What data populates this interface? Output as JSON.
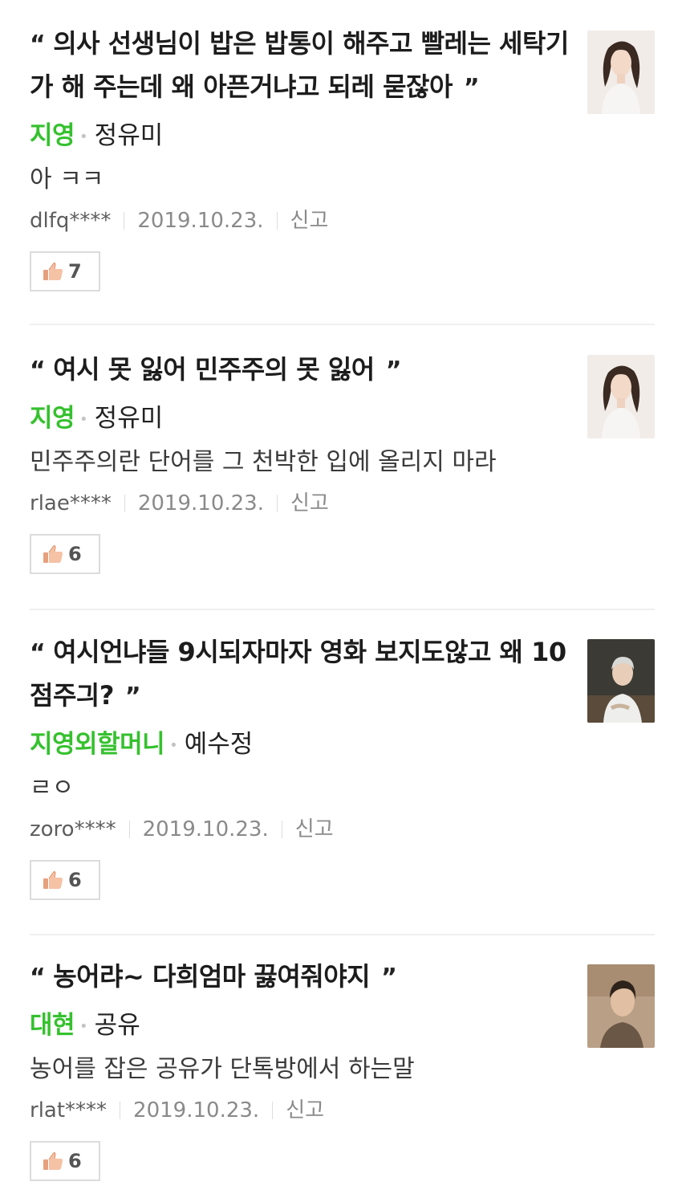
{
  "comments": [
    {
      "quote": "의사 선생님이 밥은 밥통이 해주고 빨레는 세탁기가 해 주는데 왜 아픈거냐고 되레 묻잖아",
      "role": "지영",
      "actor": "정유미",
      "text": "아 ㅋㅋ",
      "user": "dlfq****",
      "date": "2019.10.23.",
      "report_label": "신고",
      "likes": "7",
      "thumb_icon": "actress-portrait-1"
    },
    {
      "quote": "여시 못 잃어 민주주의 못 잃어",
      "role": "지영",
      "actor": "정유미",
      "text": "민주주의란 단어를 그 천박한 입에 올리지 마라",
      "user": "rlae****",
      "date": "2019.10.23.",
      "report_label": "신고",
      "likes": "6",
      "thumb_icon": "actress-portrait-1"
    },
    {
      "quote": "여시언냐들 9시되자마자 영화 보지도않고 왜 10점주긔?",
      "role": "지영외할머니",
      "actor": "예수정",
      "text": "ㄹㅇ",
      "user": "zoro****",
      "date": "2019.10.23.",
      "report_label": "신고",
      "likes": "6",
      "thumb_icon": "actress-portrait-2"
    },
    {
      "quote": "농어랴~ 다희엄마 끓여줘야지",
      "role": "대현",
      "actor": "공유",
      "text": "농어를 잡은 공유가 단톡방에서 하는말",
      "user": "rlat****",
      "date": "2019.10.23.",
      "report_label": "신고",
      "likes": "6",
      "thumb_icon": "actor-portrait"
    }
  ],
  "quote_open": "“",
  "quote_close": "”",
  "dot": "•",
  "like_icon": "thumbs-up-icon",
  "colors": {
    "role": "#35c12e",
    "divider": "#efefef"
  }
}
